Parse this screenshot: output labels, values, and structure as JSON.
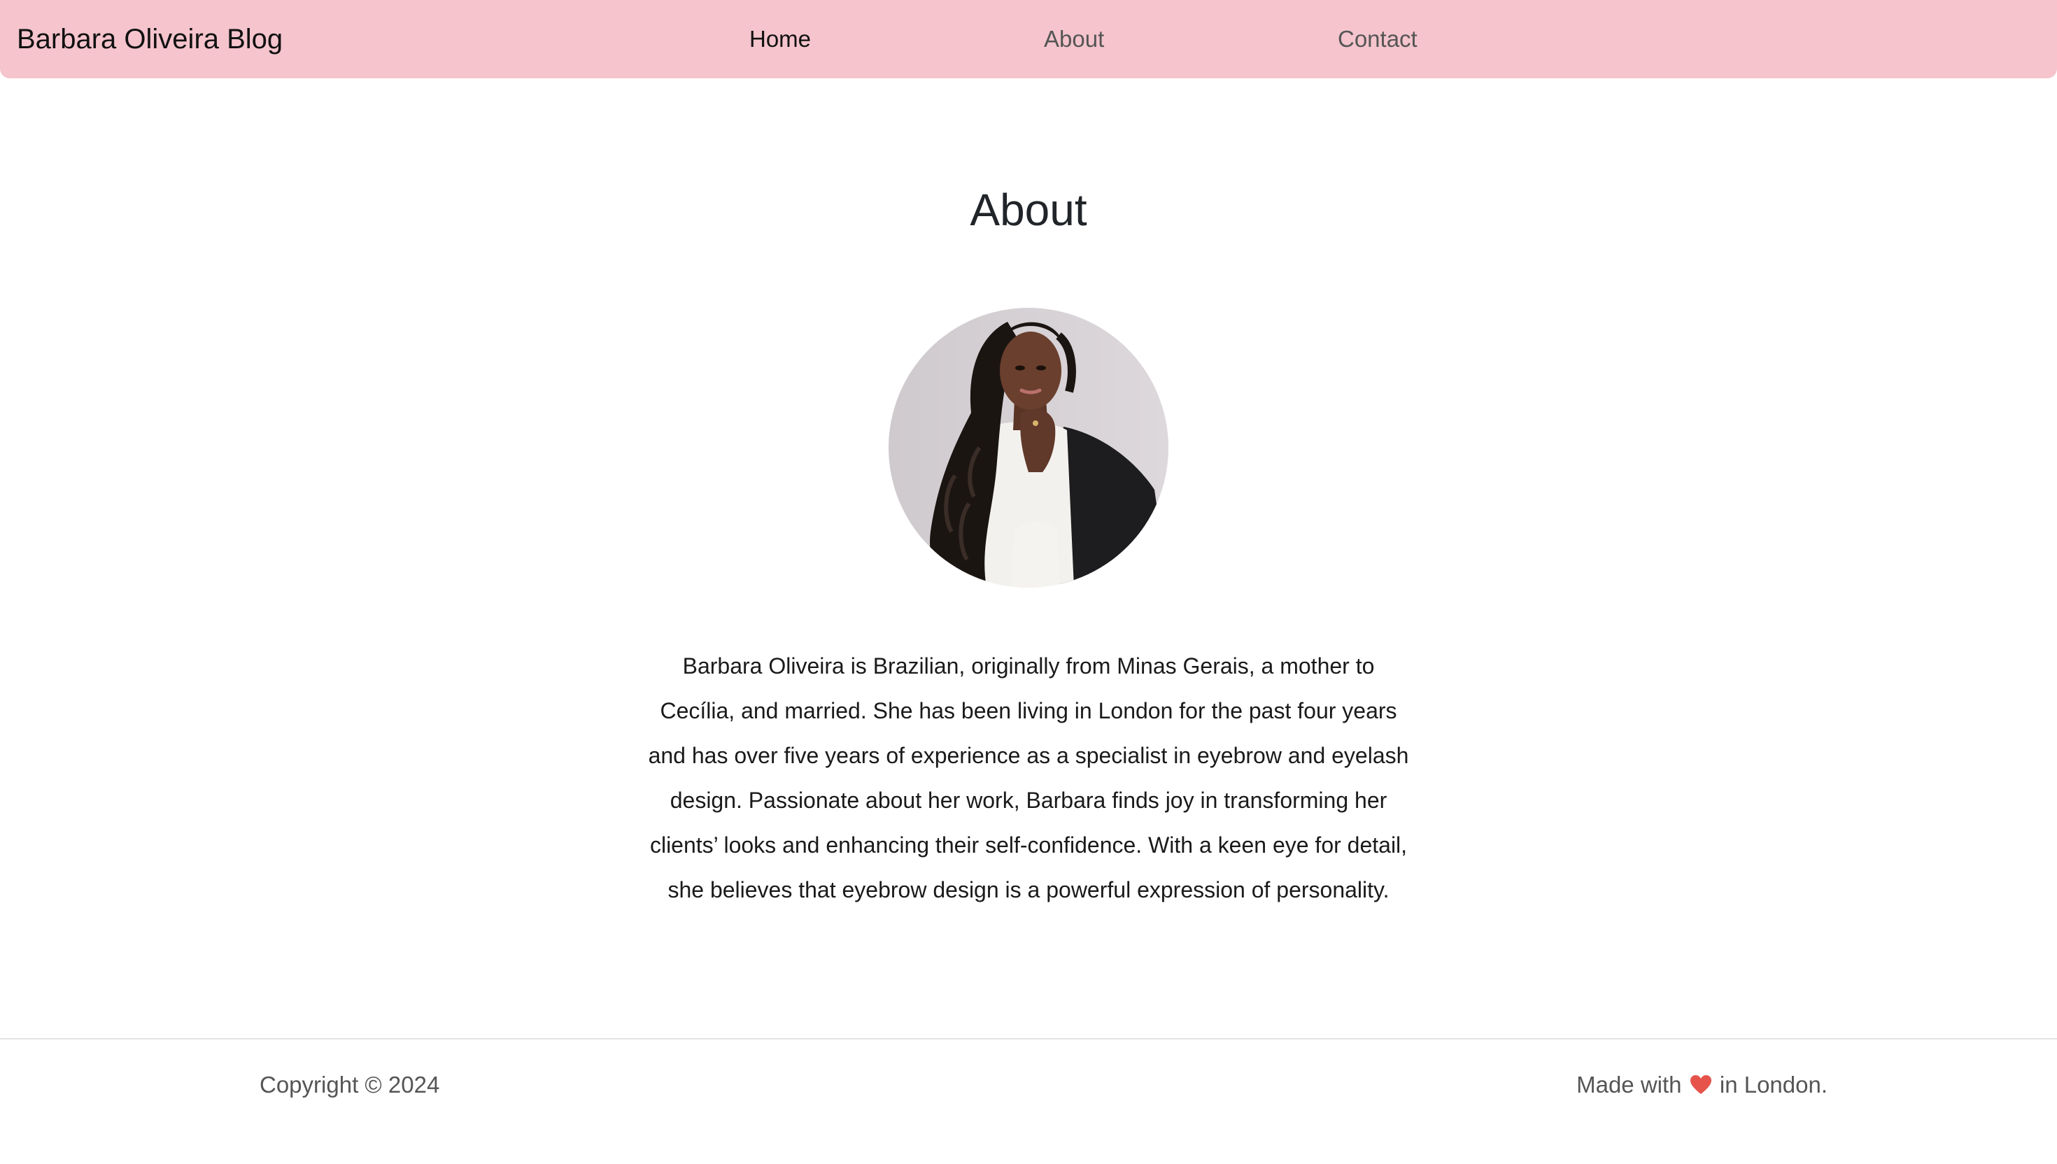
{
  "navbar": {
    "brand": "Barbara Oliveira Blog",
    "links": [
      {
        "label": "Home",
        "active": true
      },
      {
        "label": "About",
        "active": false
      },
      {
        "label": "Contact",
        "active": false
      }
    ],
    "background_color": "#f5c4cd"
  },
  "main": {
    "title": "About",
    "bio": "Barbara Oliveira is Brazilian, originally from Minas Gerais, a mother to Cecília, and married. She has been living in London for the past four years and has over five years of experience as a specialist in eyebrow and eyelash design. Passionate about her work, Barbara finds joy in transforming her clients’ looks and enhancing their self-confidence. With a keen eye for detail, she believes that eyebrow design is a powerful expression of personality."
  },
  "footer": {
    "copyright": "Copyright © 2024",
    "made_with_prefix": "Made with",
    "made_with_icon": "heart-icon",
    "made_with_suffix": "in London."
  }
}
